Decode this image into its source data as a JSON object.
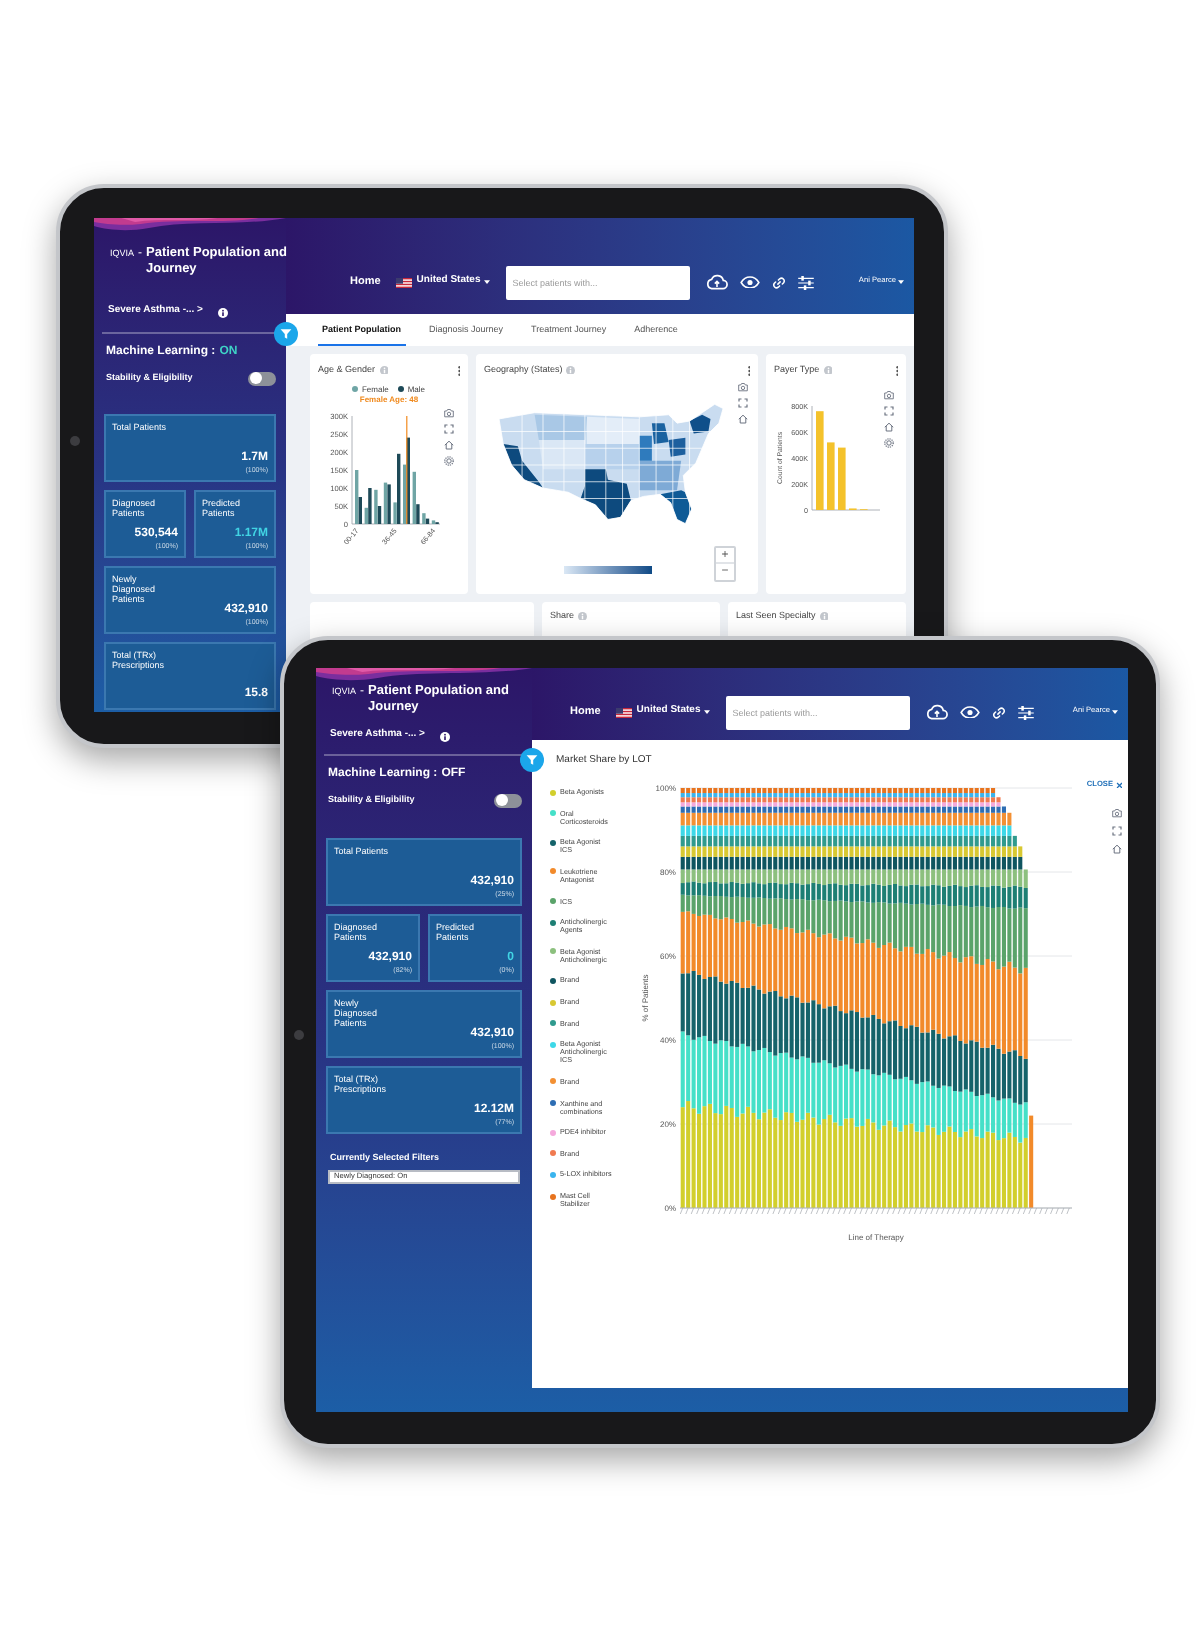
{
  "back_tablet": {
    "app_title": {
      "logo": "IQVIA",
      "separator": "-",
      "title": "Patient Population and Journey"
    },
    "nav": {
      "home": "Home",
      "country": "United States",
      "search": {
        "placeholder": "Select patients with..."
      },
      "user": "Ani Pearce"
    },
    "sidebar": {
      "cohort": "Severe Asthma -... >",
      "machine_learning": {
        "label": "Machine Learning :",
        "state": "ON",
        "on": true
      },
      "stability": {
        "label": "Stability & Eligibility",
        "on": false
      },
      "card_rows": [
        [
          {
            "label": "Total Patients",
            "value": "1.7M",
            "share": "(100%)",
            "accent": false
          }
        ],
        [
          {
            "label": "Diagnosed Patients",
            "value": "530,544",
            "share": "(100%)",
            "accent": false
          },
          {
            "label": "Predicted Patients",
            "value": "1.17M",
            "share": "(100%)",
            "accent": true
          }
        ],
        [
          {
            "label": "Newly Diagnosed Patients",
            "value": "432,910",
            "share": "(100%)",
            "accent": false
          }
        ],
        [
          {
            "label": "Total (TRx) Prescriptions",
            "value": "15.8",
            "accent": false
          }
        ]
      ]
    },
    "tabs": [
      {
        "label": "Patient Population",
        "selected": true
      },
      {
        "label": "Diagnosis Journey",
        "selected": false
      },
      {
        "label": "Treatment Journey",
        "selected": false
      },
      {
        "label": "Adherence",
        "selected": false
      }
    ],
    "panels": [
      {
        "kind": "age_gender",
        "title": "Age & Gender",
        "legend": [
          {
            "label": "Female",
            "color": "#6fa5a5"
          },
          {
            "label": "Male",
            "color": "#1e4a58"
          }
        ],
        "tooltip": "Female Age: 48",
        "y_ticks": [
          "300K",
          "250K",
          "200K",
          "150K",
          "100K",
          "50K",
          "0"
        ],
        "x_labels": [
          "00-17",
          "36-45",
          "66-84"
        ]
      },
      {
        "kind": "geography",
        "title": "Geography (States)",
        "zoom_in": "+",
        "zoom_out": "−"
      },
      {
        "kind": "payer",
        "title": "Payer Type",
        "y_label": "Count of Patients",
        "y_ticks": [
          "800K",
          "600K",
          "400K",
          "200K",
          "0"
        ]
      }
    ],
    "bottom_panels": [
      {
        "title": "Share"
      },
      {
        "title": "Last Seen Specialty"
      }
    ]
  },
  "front_tablet": {
    "app_title": {
      "logo": "IQVIA",
      "separator": "-",
      "title": "Patient Population and Journey"
    },
    "nav": {
      "home": "Home",
      "country": "United States",
      "search": {
        "placeholder": "Select patients with..."
      },
      "user": "Ani Pearce"
    },
    "sidebar": {
      "cohort": "Severe Asthma -... >",
      "machine_learning": {
        "label": "Machine Learning :",
        "state": "OFF",
        "on": false
      },
      "stability": {
        "label": "Stability & Eligibility",
        "on": false
      },
      "card_rows": [
        [
          {
            "label": "Total Patients",
            "value": "432,910",
            "share": "(25%)",
            "accent": false
          }
        ],
        [
          {
            "label": "Diagnosed Patients",
            "value": "432,910",
            "share": "(82%)",
            "accent": false
          },
          {
            "label": "Predicted Patients",
            "value": "0",
            "share": "(0%)",
            "accent": true
          }
        ],
        [
          {
            "label": "Newly Diagnosed Patients",
            "value": "432,910",
            "share": "(100%)",
            "accent": false
          }
        ],
        [
          {
            "label": "Total (TRx) Prescriptions",
            "value": "12.12M",
            "share": "(77%)",
            "accent": false
          }
        ]
      ],
      "filters": {
        "heading": "Currently Selected Filters",
        "chips": [
          "Newly Diagnosed: On"
        ]
      }
    },
    "chart_panel": {
      "title": "Market Share by LOT",
      "close": "CLOSE",
      "y_label": "% of Patients",
      "x_label": "Line of Therapy",
      "y_ticks": [
        "100%",
        "80%",
        "60%",
        "40%",
        "20%",
        "0%"
      ],
      "legend": [
        {
          "label": "Beta Agonists",
          "color": "#d2cf2c"
        },
        {
          "label": "Oral Corticosteroids",
          "color": "#45e0c8"
        },
        {
          "label": "Beta Agonist ICS",
          "color": "#15636a"
        },
        {
          "label": "Leukotriene Antagonist",
          "color": "#f28a2a"
        },
        {
          "label": "ICS",
          "color": "#5aa36a"
        },
        {
          "label": "Anticholinergic Agents",
          "color": "#1d7f74"
        },
        {
          "label": "Beta Agonist Anticholinergic",
          "color": "#8cc07e"
        },
        {
          "label": "Brand",
          "color": "#0f5560"
        },
        {
          "label": "Brand",
          "color": "#d8c832"
        },
        {
          "label": "Brand",
          "color": "#2f9a8e"
        },
        {
          "label": "Beta Agonist Anticholinergic ICS",
          "color": "#3dd8e8"
        },
        {
          "label": "Brand",
          "color": "#f39033"
        },
        {
          "label": "Xanthine and combinations",
          "color": "#2d6db3"
        },
        {
          "label": "PDE4 inhibitor",
          "color": "#f5a9dc"
        },
        {
          "label": "Brand",
          "color": "#f07a50"
        },
        {
          "label": "5-LOX inhibitors",
          "color": "#3ab4ee"
        },
        {
          "label": "Mast Cell Stabilizer",
          "color": "#e7731e"
        }
      ]
    }
  }
}
